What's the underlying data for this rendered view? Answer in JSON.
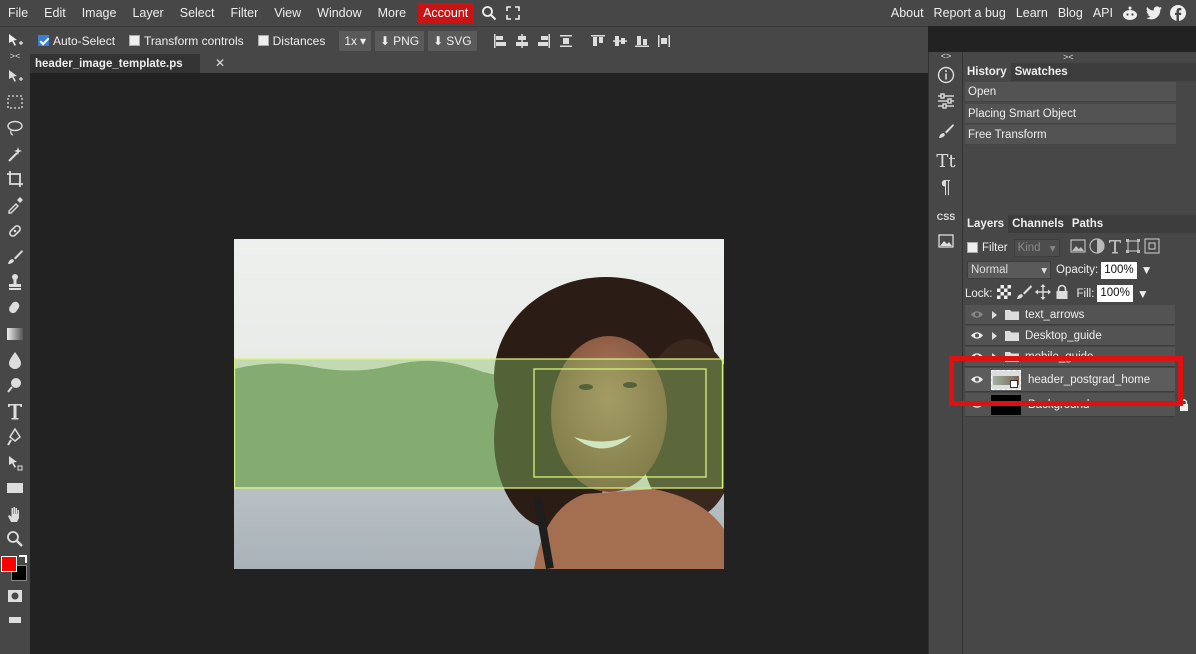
{
  "menu": {
    "items": [
      "File",
      "Edit",
      "Image",
      "Layer",
      "Select",
      "Filter",
      "View",
      "Window",
      "More"
    ],
    "account": "Account",
    "right": [
      "About",
      "Report a bug",
      "Learn",
      "Blog",
      "API"
    ]
  },
  "options": {
    "auto_select": "Auto-Select",
    "transform_controls": "Transform controls",
    "distances": "Distances",
    "zoom": "1x",
    "png": "PNG",
    "svg": "SVG"
  },
  "document": {
    "tab_title": "header_image_template.ps"
  },
  "right_narrow": {
    "collapse": "<>",
    "css": "CSS"
  },
  "history": {
    "collapse": "><",
    "tabs": [
      "History",
      "Swatches"
    ],
    "items": [
      "Open",
      "Placing Smart Object",
      "Free Transform"
    ]
  },
  "layers": {
    "tabs": [
      "Layers",
      "Channels",
      "Paths"
    ],
    "filter": "Filter",
    "kind": "Kind",
    "blend_mode": "Normal",
    "opacity_label": "Opacity:",
    "opacity_value": "100%",
    "lock_label": "Lock:",
    "fill_label": "Fill:",
    "fill_value": "100%",
    "items": [
      {
        "name": "text_arrows",
        "type": "folder"
      },
      {
        "name": "Desktop_guide",
        "type": "folder"
      },
      {
        "name": "mobile_guide",
        "type": "folder"
      },
      {
        "name": "header_postgrad_home",
        "type": "smart"
      },
      {
        "name": "Background",
        "type": "image"
      }
    ]
  },
  "colors": {
    "accent": "#c81414",
    "highlight": "#e01010",
    "foreground": "#ff0000",
    "background": "#000000"
  }
}
